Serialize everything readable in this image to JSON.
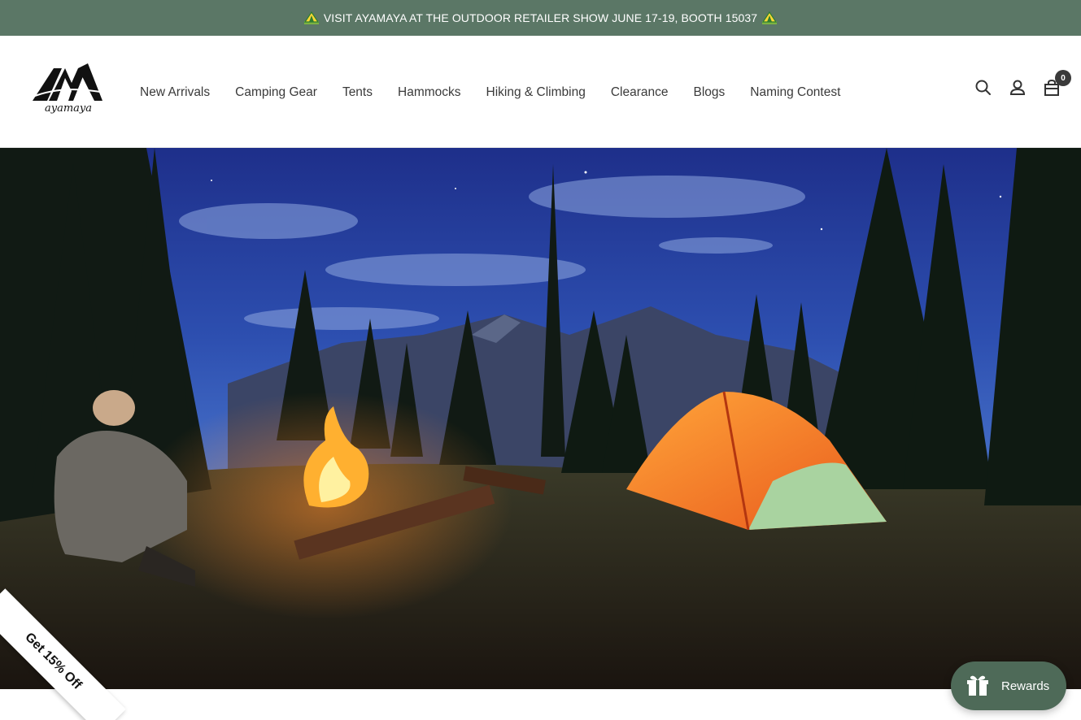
{
  "announcement": {
    "text": "VISIT AYAMAYA AT THE OUTDOOR RETAILER SHOW JUNE 17-19, BOOTH 15037",
    "icon": "tent-emoji"
  },
  "brand": {
    "logo_text": "ayamaya"
  },
  "nav": {
    "items": [
      {
        "label": "New Arrivals"
      },
      {
        "label": "Camping Gear"
      },
      {
        "label": "Tents"
      },
      {
        "label": "Hammocks"
      },
      {
        "label": "Hiking & Climbing"
      },
      {
        "label": "Clearance"
      },
      {
        "label": "Blogs"
      },
      {
        "label": "Naming Contest"
      }
    ]
  },
  "header_icons": {
    "search": "search-icon",
    "account": "user-icon",
    "cart": "cart-icon",
    "cart_count": "0"
  },
  "promo": {
    "ribbon_label": "Get 15% Off"
  },
  "rewards": {
    "label": "Rewards",
    "icon": "gift-icon"
  },
  "colors": {
    "announcement_bg": "#5b7766",
    "rewards_bg": "#4e6a58",
    "nav_text": "#3a3a3a"
  }
}
